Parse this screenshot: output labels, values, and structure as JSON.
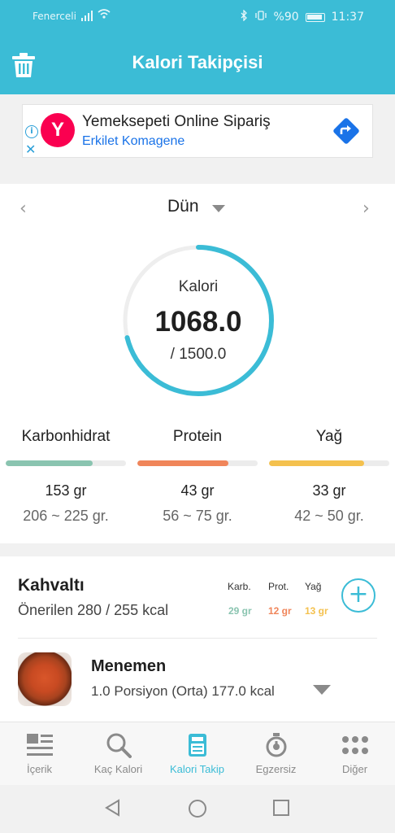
{
  "status_bar": {
    "carrier": "Fenerceli",
    "battery": "%90",
    "time": "11:37"
  },
  "app_bar": {
    "title": "Kalori Takipçisi",
    "trash_icon": "trash-icon"
  },
  "ad": {
    "logo_letter": "Y",
    "title": "Yemeksepeti Online Sipariş",
    "subtitle": "Erkilet Komagene",
    "brand_color": "#fa0050"
  },
  "day_nav": {
    "label": "Dün"
  },
  "calories": {
    "label": "Kalori",
    "consumed": "1068.0",
    "goal": "/ 1500.0",
    "progress": 0.712,
    "ring_color": "#3bbcd6"
  },
  "macros": [
    {
      "name": "Karbonhidrat",
      "amount": "153 gr",
      "range": "206 ~ 225 gr.",
      "progress": 0.72,
      "color": "#8ac4b0"
    },
    {
      "name": "Protein",
      "amount": "43 gr",
      "range": "56 ~ 75 gr.",
      "progress": 0.76,
      "color": "#f0855a"
    },
    {
      "name": "Yağ",
      "amount": "33 gr",
      "range": "42 ~ 50 gr.",
      "progress": 0.79,
      "color": "#f4c14e"
    }
  ],
  "meal": {
    "title": "Kahvaltı",
    "suggested": "Önerilen 280 / 255 kcal",
    "macro_headers": [
      "Karb.",
      "Prot.",
      "Yağ"
    ],
    "macro_values": [
      "29 gr",
      "12 gr",
      "13 gr"
    ],
    "macro_colors": [
      "#8ac4b0",
      "#f0855a",
      "#f4c14e"
    ],
    "add_label": "+",
    "food": {
      "name": "Menemen",
      "description": "1.0 Porsiyon (Orta) 177.0 kcal"
    }
  },
  "bottom_nav": [
    {
      "label": "İçerik",
      "icon": "newspaper-icon",
      "active": false
    },
    {
      "label": "Kaç Kalori",
      "icon": "search-icon",
      "active": false
    },
    {
      "label": "Kalori Takip",
      "icon": "scale-icon",
      "active": true
    },
    {
      "label": "Egzersiz",
      "icon": "stopwatch-icon",
      "active": false
    },
    {
      "label": "Diğer",
      "icon": "more-grid-icon",
      "active": false
    }
  ]
}
